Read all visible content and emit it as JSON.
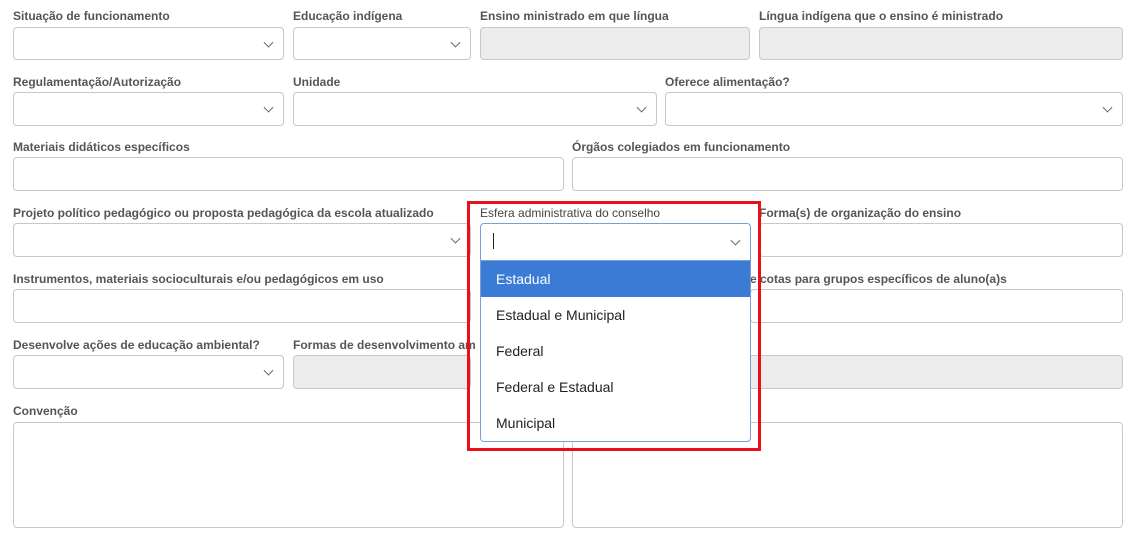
{
  "labels": {
    "situacao": "Situação de funcionamento",
    "educacao_indigena": "Educação indígena",
    "ensino_lingua": "Ensino ministrado em que língua",
    "lingua_indigena": "Língua indígena que o ensino é ministrado",
    "regulamentacao": "Regulamentação/Autorização",
    "unidade": "Unidade",
    "alimentacao": "Oferece alimentação?",
    "materiais": "Materiais didáticos específicos",
    "orgaos": "Órgãos colegiados em funcionamento",
    "projeto": "Projeto político pedagógico ou proposta pedagógica da escola atualizado",
    "esfera": "Esfera administrativa do conselho",
    "forma_org": "Forma(s) de organização do ensino",
    "instrumentos": "Instrumentos, materiais socioculturais e/ou pedagógicos em uso",
    "cotas_partial": "e cotas para grupos específicos de aluno(a)s",
    "educacao_ambiental": "Desenvolve ações de educação ambiental?",
    "formas_partial": "Formas de desenvolvimento am",
    "convencao": "Convenção"
  },
  "esfera_dropdown": {
    "value": "",
    "options": [
      "Estadual",
      "Estadual e Municipal",
      "Federal",
      "Federal e Estadual",
      "Municipal"
    ],
    "active_index": 0
  },
  "colors": {
    "active_option": "#3a7bd5",
    "highlight": "#e8101a"
  }
}
